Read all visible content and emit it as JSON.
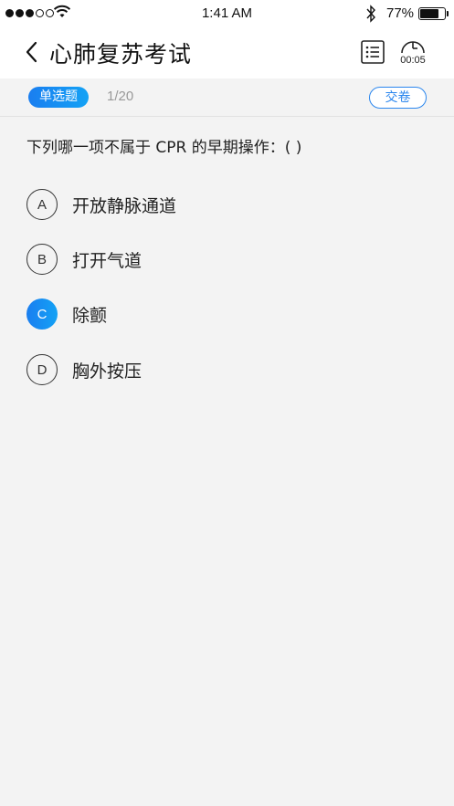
{
  "status_bar": {
    "time": "1:41 AM",
    "battery_percent": "77%",
    "battery_level": 0.77,
    "signal_bars_filled": 3,
    "signal_bars_total": 5
  },
  "nav": {
    "title": "心肺复苏考试",
    "timer": "00:05"
  },
  "question_bar": {
    "type_label": "单选题",
    "progress": "1/20",
    "submit_label": "交卷"
  },
  "question": {
    "text": "下列哪一项不属于 CPR 的早期操作：( )",
    "selected": "C",
    "options": [
      {
        "letter": "A",
        "text": "开放静脉通道"
      },
      {
        "letter": "B",
        "text": "打开气道"
      },
      {
        "letter": "C",
        "text": "除颤"
      },
      {
        "letter": "D",
        "text": "胸外按压"
      }
    ]
  },
  "colors": {
    "accent": "#1a7ef0",
    "accent_light": "#13a2f5",
    "background": "#f3f3f3"
  }
}
